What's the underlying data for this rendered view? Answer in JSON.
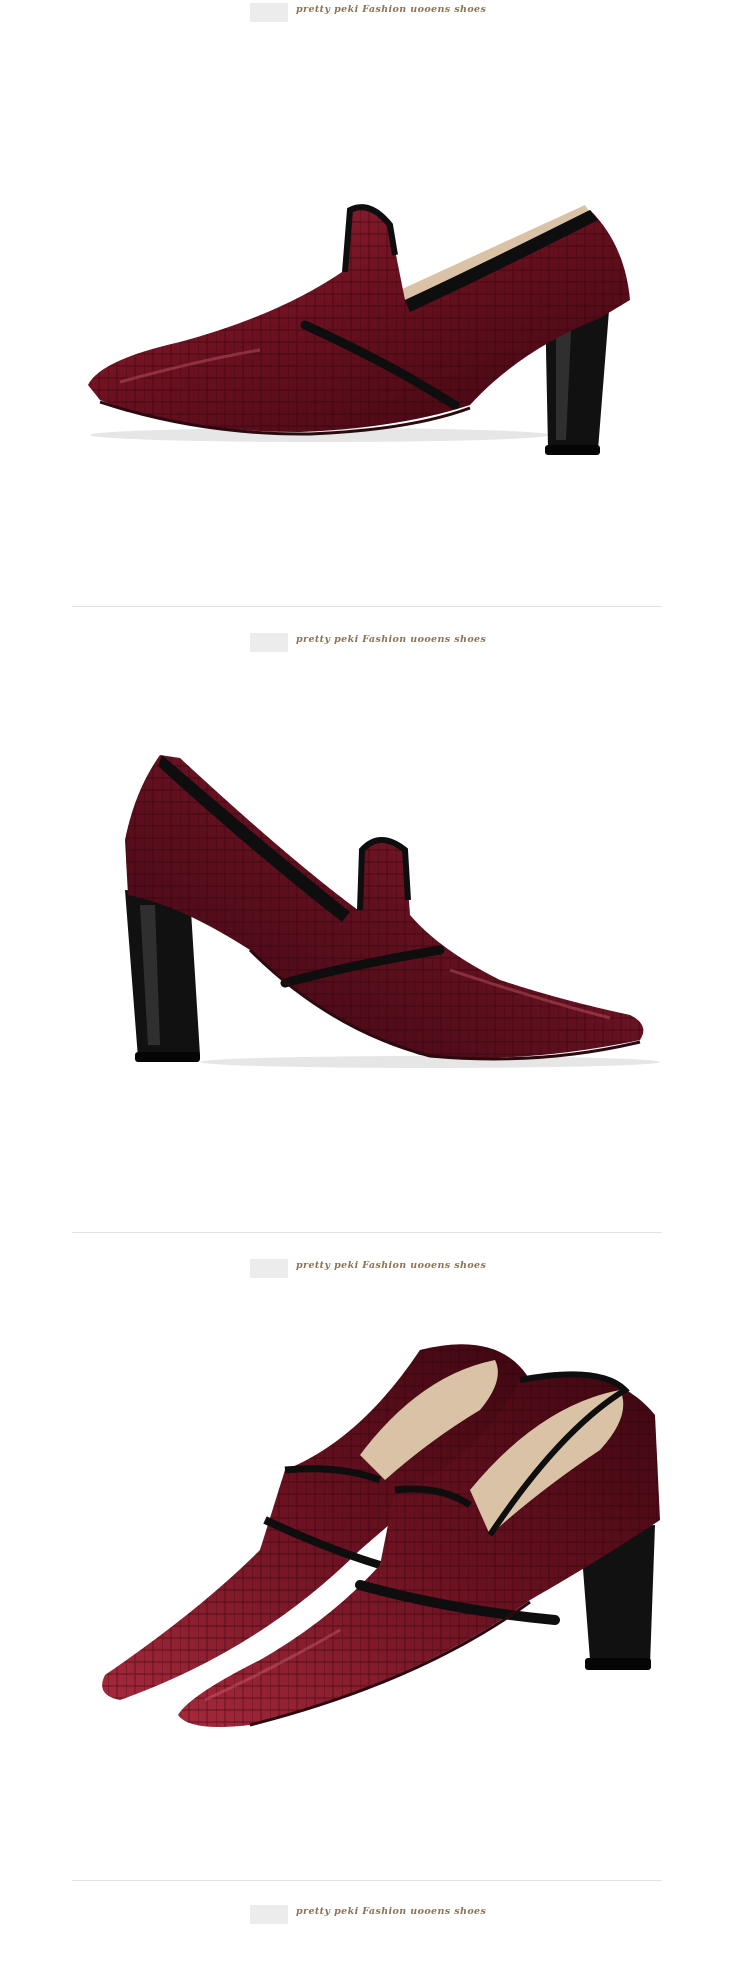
{
  "brand_tagline": "pretty peki Fashion uooens shoes",
  "sections": [
    {
      "label": "pretty peki Fashion uooens shoes",
      "photo": "shoe-side-view-right"
    },
    {
      "label": "pretty peki Fashion uooens shoes",
      "photo": "shoe-side-view-left"
    },
    {
      "label": "pretty peki Fashion uooens shoes",
      "photo": "shoe-pair-front-view"
    },
    {
      "label": "pretty peki Fashion uooens shoes",
      "photo": ""
    }
  ],
  "colors": {
    "leather": "#5a0a14",
    "leather_highlight": "#a3283a",
    "trim": "#0e0e0e",
    "lining": "#d9c2a5",
    "brand_text": "#8a7356"
  }
}
